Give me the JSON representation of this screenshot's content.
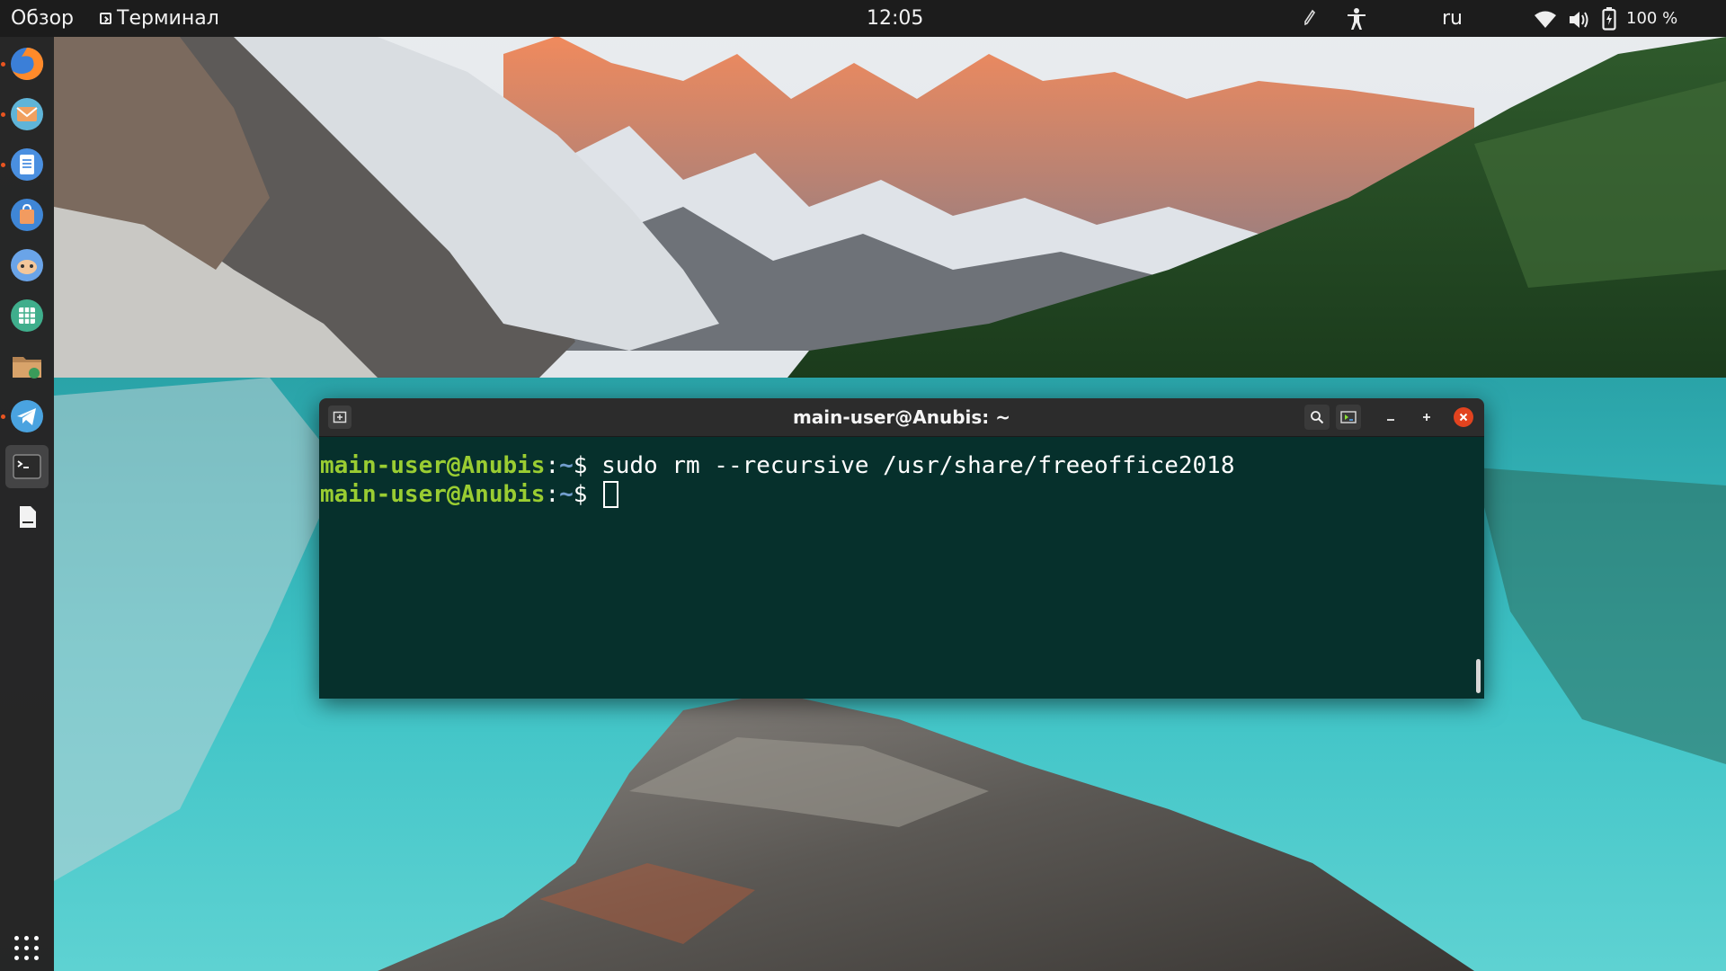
{
  "topbar": {
    "activities_label": "Обзор",
    "app_menu_label": "Терминал",
    "clock": "12:05",
    "language": "ru",
    "battery_percent": "100 %",
    "tray_icons": [
      "pen-icon",
      "accessibility-icon",
      "wifi-icon",
      "volume-icon",
      "battery-icon"
    ]
  },
  "dock": {
    "apps": [
      {
        "name": "firefox",
        "icon": "firefox-icon",
        "running": true
      },
      {
        "name": "thunderbird",
        "icon": "mail-icon",
        "running": true
      },
      {
        "name": "text-editor",
        "icon": "document-icon",
        "running": true
      },
      {
        "name": "software-center",
        "icon": "bag-icon",
        "running": false
      },
      {
        "name": "remote",
        "icon": "remote-icon",
        "running": false
      },
      {
        "name": "spreadsheet",
        "icon": "spreadsheet-icon",
        "running": false
      },
      {
        "name": "files",
        "icon": "folder-icon",
        "running": false
      },
      {
        "name": "telegram",
        "icon": "telegram-icon",
        "running": true
      },
      {
        "name": "terminal",
        "icon": "terminal-icon",
        "running": false,
        "active": true
      },
      {
        "name": "text-file",
        "icon": "file-icon",
        "running": false
      }
    ],
    "show_apps_icon": "grid-icon"
  },
  "terminal": {
    "title": "main-user@Anubis: ~",
    "lines": [
      {
        "user": "main-user@Anubis",
        "sep": ":",
        "path": "~",
        "symbol": "$ ",
        "command": "sudo rm --recursive /usr/share/freeoffice2018"
      },
      {
        "user": "main-user@Anubis",
        "sep": ":",
        "path": "~",
        "symbol": "$ ",
        "command": ""
      }
    ],
    "colors": {
      "background": "#06302c",
      "user": "#9acd32",
      "path": "#729fcf",
      "close": "#e2431f"
    }
  }
}
